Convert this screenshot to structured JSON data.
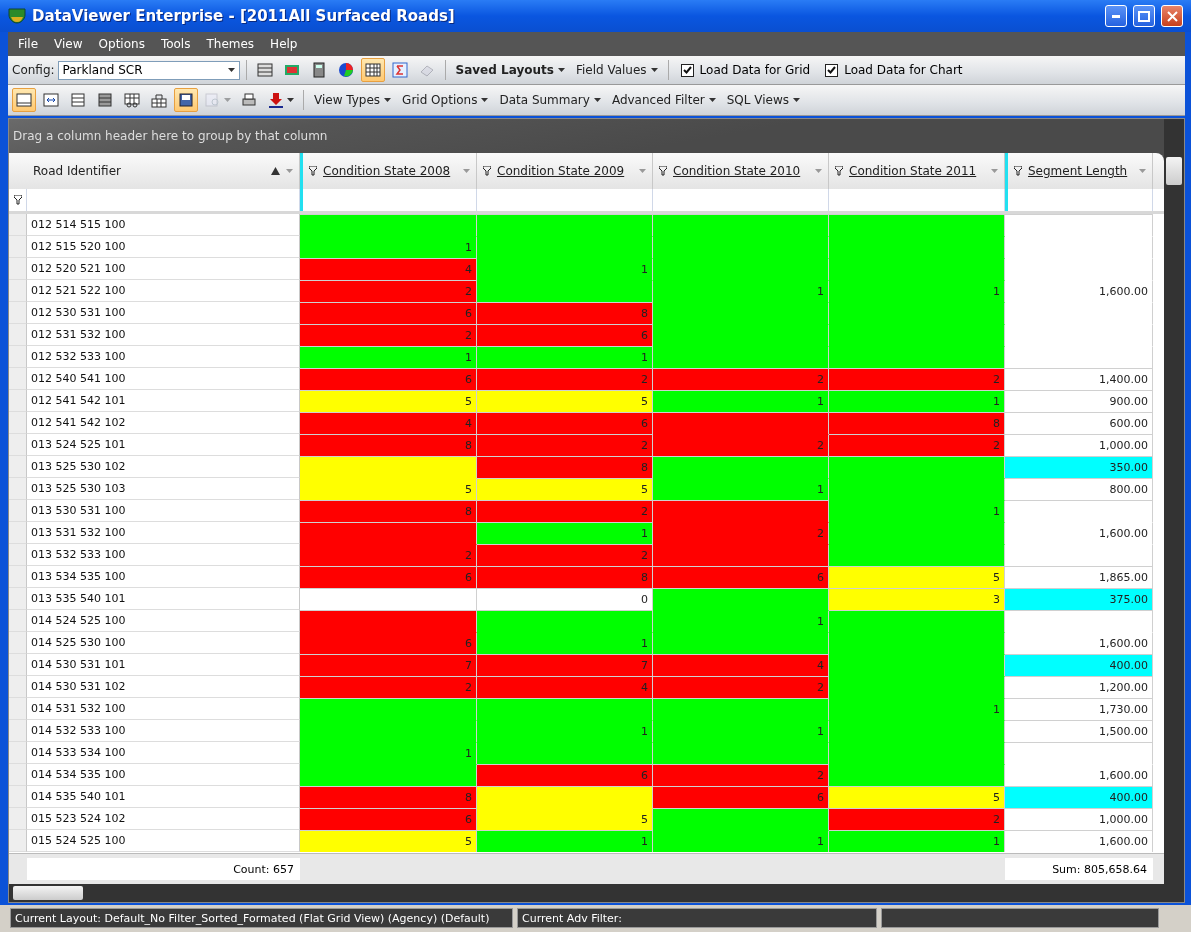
{
  "window": {
    "title": "DataViewer Enterprise - [2011All Surfaced Roads]"
  },
  "menu": [
    "File",
    "View",
    "Options",
    "Tools",
    "Themes",
    "Help"
  ],
  "toolbar": {
    "config_label": "Config:",
    "config_value": "Parkland SCR",
    "icon_buttons": [
      {
        "pressed": false,
        "disabled": false
      },
      {
        "pressed": false,
        "disabled": false
      },
      {
        "pressed": false,
        "disabled": false
      },
      {
        "pressed": false,
        "disabled": false
      },
      {
        "pressed": true,
        "disabled": false
      },
      {
        "pressed": false,
        "disabled": false
      },
      {
        "pressed": false,
        "disabled": true
      }
    ],
    "menus": [
      "Saved Layouts",
      "Field Values"
    ],
    "checkboxes": [
      {
        "label": "Load Data for Grid",
        "checked": true
      },
      {
        "label": "Load Data for Chart",
        "checked": true
      }
    ]
  },
  "toolbar2": {
    "icon_buttons": [
      {
        "pressed": true,
        "disabled": false
      },
      {
        "pressed": false,
        "disabled": false
      },
      {
        "pressed": false,
        "disabled": false
      },
      {
        "pressed": false,
        "disabled": false
      },
      {
        "pressed": false,
        "disabled": false
      },
      {
        "pressed": false,
        "disabled": false
      },
      {
        "pressed": true,
        "disabled": false
      },
      {
        "pressed": false,
        "disabled": true
      },
      {
        "pressed": false,
        "disabled": false
      },
      {
        "pressed": false,
        "disabled": false
      }
    ],
    "menus": [
      "View Types",
      "Grid Options",
      "Data Summary",
      "Advanced Filter",
      "SQL Views"
    ]
  },
  "grid": {
    "group_panel": "Drag a column header here to group by that column",
    "columns": [
      {
        "label": "Road Identifier",
        "sorted": true,
        "filter_icon": false
      },
      {
        "label": "Condition State 2008",
        "sorted": false,
        "filter_icon": true
      },
      {
        "label": "Condition State 2009",
        "sorted": false,
        "filter_icon": true
      },
      {
        "label": "Condition State 2010",
        "sorted": false,
        "filter_icon": true
      },
      {
        "label": "Condition State 2011",
        "sorted": false,
        "filter_icon": true
      },
      {
        "label": "Segment Length",
        "sorted": false,
        "filter_icon": true
      }
    ],
    "rows": [
      {
        "road_identifier": "012 514 515 100",
        "cells": [
          {
            "merged": false,
            "color": "#00ff00"
          },
          {
            "merged": false,
            "color": "#00ff00"
          },
          {
            "merged": false,
            "color": "#00ff00"
          },
          {
            "merged": false,
            "color": "#00ff00"
          },
          {
            "merged": false,
            "color": "#ffffff"
          }
        ]
      },
      {
        "road_identifier": "012 515 520 100",
        "cells": [
          {
            "merged": true,
            "color": "#00ff00",
            "value": "1"
          },
          {
            "merged": true,
            "color": "#00ff00"
          },
          {
            "merged": true,
            "color": "#00ff00"
          },
          {
            "merged": true,
            "color": "#00ff00"
          },
          {
            "merged": true,
            "color": "#ffffff"
          }
        ]
      },
      {
        "road_identifier": "012 520 521 100",
        "cells": [
          {
            "merged": false,
            "color": "#ff0000",
            "value": "4"
          },
          {
            "merged": true,
            "color": "#00ff00",
            "value": "1"
          },
          {
            "merged": true,
            "color": "#00ff00"
          },
          {
            "merged": true,
            "color": "#00ff00"
          },
          {
            "merged": true,
            "color": "#ffffff"
          }
        ]
      },
      {
        "road_identifier": "012 521 522 100",
        "cells": [
          {
            "merged": false,
            "color": "#ff0000",
            "value": "2"
          },
          {
            "merged": true,
            "color": "#00ff00"
          },
          {
            "merged": true,
            "color": "#00ff00",
            "value": "1"
          },
          {
            "merged": true,
            "color": "#00ff00",
            "value": "1"
          },
          {
            "merged": true,
            "color": "#ffffff",
            "value": "1,600.00"
          }
        ]
      },
      {
        "road_identifier": "012 530 531 100",
        "cells": [
          {
            "merged": false,
            "color": "#ff0000",
            "value": "6"
          },
          {
            "merged": false,
            "color": "#ff0000",
            "value": "8"
          },
          {
            "merged": true,
            "color": "#00ff00"
          },
          {
            "merged": true,
            "color": "#00ff00"
          },
          {
            "merged": true,
            "color": "#ffffff"
          }
        ]
      },
      {
        "road_identifier": "012 531 532 100",
        "cells": [
          {
            "merged": false,
            "color": "#ff0000",
            "value": "2"
          },
          {
            "merged": false,
            "color": "#ff0000",
            "value": "6"
          },
          {
            "merged": true,
            "color": "#00ff00"
          },
          {
            "merged": true,
            "color": "#00ff00"
          },
          {
            "merged": true,
            "color": "#ffffff"
          }
        ]
      },
      {
        "road_identifier": "012 532 533 100",
        "cells": [
          {
            "merged": false,
            "color": "#00ff00",
            "value": "1"
          },
          {
            "merged": false,
            "color": "#00ff00",
            "value": "1"
          },
          {
            "merged": true,
            "color": "#00ff00"
          },
          {
            "merged": true,
            "color": "#00ff00"
          },
          {
            "merged": true,
            "color": "#ffffff"
          }
        ]
      },
      {
        "road_identifier": "012 540 541 100",
        "cells": [
          {
            "merged": false,
            "color": "#ff0000",
            "value": "6"
          },
          {
            "merged": false,
            "color": "#ff0000",
            "value": "2"
          },
          {
            "merged": false,
            "color": "#ff0000",
            "value": "2"
          },
          {
            "merged": false,
            "color": "#ff0000",
            "value": "2"
          },
          {
            "merged": false,
            "color": "#ffffff",
            "value": "1,400.00"
          }
        ]
      },
      {
        "road_identifier": "012 541 542 101",
        "cells": [
          {
            "merged": false,
            "color": "#ffff00",
            "value": "5"
          },
          {
            "merged": false,
            "color": "#ffff00",
            "value": "5"
          },
          {
            "merged": false,
            "color": "#00ff00",
            "value": "1"
          },
          {
            "merged": false,
            "color": "#00ff00",
            "value": "1"
          },
          {
            "merged": false,
            "color": "#ffffff",
            "value": "900.00"
          }
        ]
      },
      {
        "road_identifier": "012 541 542 102",
        "cells": [
          {
            "merged": false,
            "color": "#ff0000",
            "value": "4"
          },
          {
            "merged": false,
            "color": "#ff0000",
            "value": "6"
          },
          {
            "merged": false,
            "color": "#ff0000"
          },
          {
            "merged": false,
            "color": "#ff0000",
            "value": "8"
          },
          {
            "merged": false,
            "color": "#ffffff",
            "value": "600.00"
          }
        ]
      },
      {
        "road_identifier": "013 524 525 101",
        "cells": [
          {
            "merged": false,
            "color": "#ff0000",
            "value": "8"
          },
          {
            "merged": false,
            "color": "#ff0000",
            "value": "2"
          },
          {
            "merged": true,
            "color": "#ff0000",
            "value": "2"
          },
          {
            "merged": false,
            "color": "#ff0000",
            "value": "2"
          },
          {
            "merged": false,
            "color": "#ffffff",
            "value": "1,000.00"
          }
        ]
      },
      {
        "road_identifier": "013 525 530 102",
        "cells": [
          {
            "merged": false,
            "color": "#ffff00"
          },
          {
            "merged": false,
            "color": "#ff0000",
            "value": "8"
          },
          {
            "merged": false,
            "color": "#00ff00"
          },
          {
            "merged": false,
            "color": "#00ff00"
          },
          {
            "merged": false,
            "color": "#00ffff",
            "value": "350.00"
          }
        ]
      },
      {
        "road_identifier": "013 525 530 103",
        "cells": [
          {
            "merged": true,
            "color": "#ffff00",
            "value": "5"
          },
          {
            "merged": false,
            "color": "#ffff00",
            "value": "5"
          },
          {
            "merged": true,
            "color": "#00ff00",
            "value": "1"
          },
          {
            "merged": true,
            "color": "#00ff00"
          },
          {
            "merged": false,
            "color": "#ffffff",
            "value": "800.00"
          }
        ]
      },
      {
        "road_identifier": "013 530 531 100",
        "cells": [
          {
            "merged": false,
            "color": "#ff0000",
            "value": "8"
          },
          {
            "merged": false,
            "color": "#ff0000",
            "value": "2"
          },
          {
            "merged": false,
            "color": "#ff0000"
          },
          {
            "merged": true,
            "color": "#00ff00",
            "value": "1"
          },
          {
            "merged": false,
            "color": "#ffffff"
          }
        ]
      },
      {
        "road_identifier": "013 531 532 100",
        "cells": [
          {
            "merged": false,
            "color": "#ff0000"
          },
          {
            "merged": false,
            "color": "#00ff00",
            "value": "1"
          },
          {
            "merged": true,
            "color": "#ff0000",
            "value": "2"
          },
          {
            "merged": true,
            "color": "#00ff00"
          },
          {
            "merged": true,
            "color": "#ffffff",
            "value": "1,600.00"
          }
        ]
      },
      {
        "road_identifier": "013 532 533 100",
        "cells": [
          {
            "merged": true,
            "color": "#ff0000",
            "value": "2"
          },
          {
            "merged": false,
            "color": "#ff0000",
            "value": "2"
          },
          {
            "merged": true,
            "color": "#ff0000"
          },
          {
            "merged": true,
            "color": "#00ff00"
          },
          {
            "merged": true,
            "color": "#ffffff"
          }
        ]
      },
      {
        "road_identifier": "013 534 535 100",
        "cells": [
          {
            "merged": false,
            "color": "#ff0000",
            "value": "6"
          },
          {
            "merged": false,
            "color": "#ff0000",
            "value": "8"
          },
          {
            "merged": false,
            "color": "#ff0000",
            "value": "6"
          },
          {
            "merged": false,
            "color": "#ffff00",
            "value": "5"
          },
          {
            "merged": false,
            "color": "#ffffff",
            "value": "1,865.00"
          }
        ]
      },
      {
        "road_identifier": "013 535 540 101",
        "cells": [
          {
            "merged": false,
            "color": "#ffffff"
          },
          {
            "merged": false,
            "color": "#ffffff",
            "value": "0"
          },
          {
            "merged": false,
            "color": "#00ff00"
          },
          {
            "merged": false,
            "color": "#ffff00",
            "value": "3"
          },
          {
            "merged": false,
            "color": "#00ffff",
            "value": "375.00"
          }
        ]
      },
      {
        "road_identifier": "014 524 525 100",
        "cells": [
          {
            "merged": false,
            "color": "#ff0000"
          },
          {
            "merged": false,
            "color": "#00ff00"
          },
          {
            "merged": true,
            "color": "#00ff00",
            "value": "1"
          },
          {
            "merged": false,
            "color": "#00ff00"
          },
          {
            "merged": false,
            "color": "#ffffff"
          }
        ]
      },
      {
        "road_identifier": "014 525 530 100",
        "cells": [
          {
            "merged": true,
            "color": "#ff0000",
            "value": "6"
          },
          {
            "merged": true,
            "color": "#00ff00",
            "value": "1"
          },
          {
            "merged": true,
            "color": "#00ff00"
          },
          {
            "merged": true,
            "color": "#00ff00"
          },
          {
            "merged": true,
            "color": "#ffffff",
            "value": "1,600.00"
          }
        ]
      },
      {
        "road_identifier": "014 530 531 101",
        "cells": [
          {
            "merged": false,
            "color": "#ff0000",
            "value": "7"
          },
          {
            "merged": false,
            "color": "#ff0000",
            "value": "7"
          },
          {
            "merged": false,
            "color": "#ff0000",
            "value": "4"
          },
          {
            "merged": true,
            "color": "#00ff00"
          },
          {
            "merged": false,
            "color": "#00ffff",
            "value": "400.00"
          }
        ]
      },
      {
        "road_identifier": "014 530 531 102",
        "cells": [
          {
            "merged": false,
            "color": "#ff0000",
            "value": "2"
          },
          {
            "merged": false,
            "color": "#ff0000",
            "value": "4"
          },
          {
            "merged": false,
            "color": "#ff0000",
            "value": "2"
          },
          {
            "merged": true,
            "color": "#00ff00"
          },
          {
            "merged": false,
            "color": "#ffffff",
            "value": "1,200.00"
          }
        ]
      },
      {
        "road_identifier": "014 531 532 100",
        "cells": [
          {
            "merged": false,
            "color": "#00ff00"
          },
          {
            "merged": false,
            "color": "#00ff00"
          },
          {
            "merged": false,
            "color": "#00ff00"
          },
          {
            "merged": true,
            "color": "#00ff00",
            "value": "1"
          },
          {
            "merged": false,
            "color": "#ffffff",
            "value": "1,730.00"
          }
        ]
      },
      {
        "road_identifier": "014 532 533 100",
        "cells": [
          {
            "merged": true,
            "color": "#00ff00"
          },
          {
            "merged": true,
            "color": "#00ff00",
            "value": "1"
          },
          {
            "merged": true,
            "color": "#00ff00",
            "value": "1"
          },
          {
            "merged": true,
            "color": "#00ff00"
          },
          {
            "merged": false,
            "color": "#ffffff",
            "value": "1,500.00"
          }
        ]
      },
      {
        "road_identifier": "014 533 534 100",
        "cells": [
          {
            "merged": true,
            "color": "#00ff00",
            "value": "1"
          },
          {
            "merged": true,
            "color": "#00ff00"
          },
          {
            "merged": true,
            "color": "#00ff00"
          },
          {
            "merged": true,
            "color": "#00ff00"
          },
          {
            "merged": false,
            "color": "#ffffff"
          }
        ]
      },
      {
        "road_identifier": "014 534 535 100",
        "cells": [
          {
            "merged": true,
            "color": "#00ff00"
          },
          {
            "merged": false,
            "color": "#ff0000",
            "value": "6"
          },
          {
            "merged": false,
            "color": "#ff0000",
            "value": "2"
          },
          {
            "merged": true,
            "color": "#00ff00"
          },
          {
            "merged": true,
            "color": "#ffffff",
            "value": "1,600.00"
          }
        ]
      },
      {
        "road_identifier": "014 535 540 101",
        "cells": [
          {
            "merged": false,
            "color": "#ff0000",
            "value": "8"
          },
          {
            "merged": false,
            "color": "#ffff00"
          },
          {
            "merged": false,
            "color": "#ff0000",
            "value": "6"
          },
          {
            "merged": false,
            "color": "#ffff00",
            "value": "5"
          },
          {
            "merged": false,
            "color": "#00ffff",
            "value": "400.00"
          }
        ]
      },
      {
        "road_identifier": "015 523 524 102",
        "cells": [
          {
            "merged": false,
            "color": "#ff0000",
            "value": "6"
          },
          {
            "merged": true,
            "color": "#ffff00",
            "value": "5"
          },
          {
            "merged": false,
            "color": "#00ff00"
          },
          {
            "merged": false,
            "color": "#ff0000",
            "value": "2"
          },
          {
            "merged": false,
            "color": "#ffffff",
            "value": "1,000.00"
          }
        ]
      },
      {
        "road_identifier": "015 524 525 100",
        "cells": [
          {
            "merged": false,
            "color": "#ffff00",
            "value": "5"
          },
          {
            "merged": false,
            "color": "#00ff00",
            "value": "1"
          },
          {
            "merged": true,
            "color": "#00ff00",
            "value": "1"
          },
          {
            "merged": false,
            "color": "#00ff00",
            "value": "1"
          },
          {
            "merged": false,
            "color": "#ffffff",
            "value": "1,600.00"
          }
        ]
      }
    ],
    "footer": {
      "count": "Count: 657",
      "sum": "Sum: 805,658.64"
    }
  },
  "status_bar": [
    "Current Layout: Default_No Filter_Sorted_Formated (Flat Grid View) (Agency) (Default)",
    "Current Adv Filter:"
  ]
}
